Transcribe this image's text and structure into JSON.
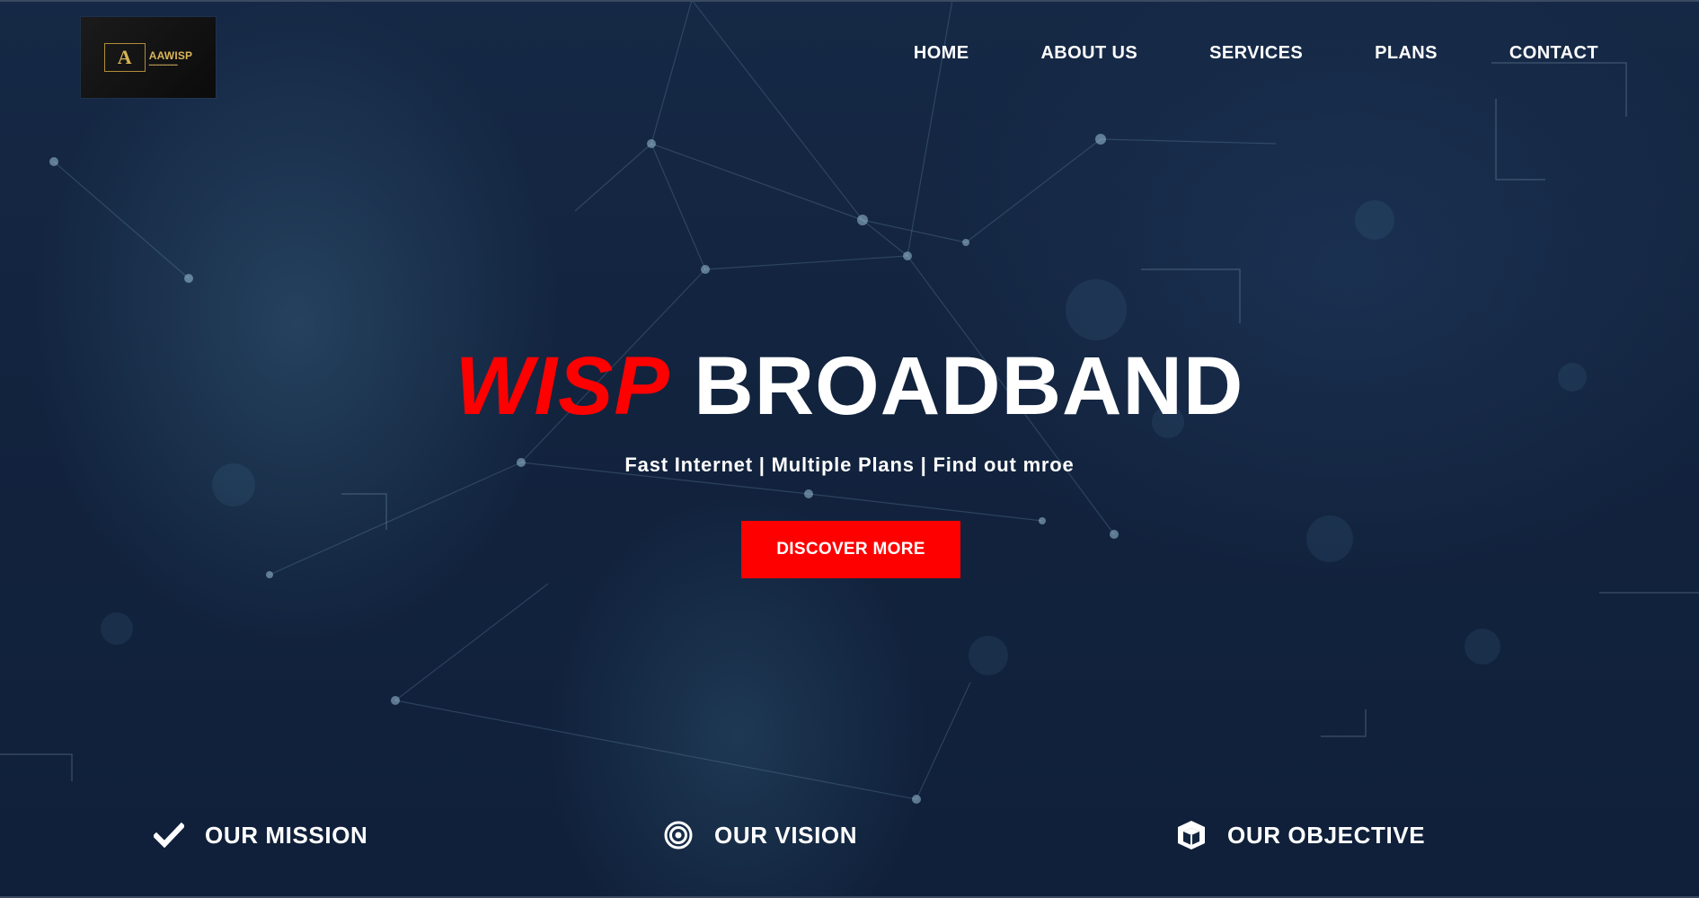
{
  "header": {
    "logo": {
      "mark": "A",
      "name": "AAWISP"
    },
    "nav": [
      {
        "label": "HOME"
      },
      {
        "label": "ABOUT US"
      },
      {
        "label": "SERVICES"
      },
      {
        "label": "PLANS"
      },
      {
        "label": "CONTACT"
      }
    ]
  },
  "hero": {
    "title_accent": "WISP",
    "title_main": "BROADBAND",
    "subtitle": "Fast Internet | Multiple Plans | Find out mroe",
    "cta_label": "DISCOVER MORE"
  },
  "features": [
    {
      "label": "OUR MISSION",
      "icon": "checkmark-icon"
    },
    {
      "label": "OUR VISION",
      "icon": "target-icon"
    },
    {
      "label": "OUR OBJECTIVE",
      "icon": "cube-icon"
    }
  ],
  "colors": {
    "accent": "#ff0000",
    "background": "#12233e",
    "text": "#ffffff",
    "logo_gold": "#d9b65a"
  }
}
